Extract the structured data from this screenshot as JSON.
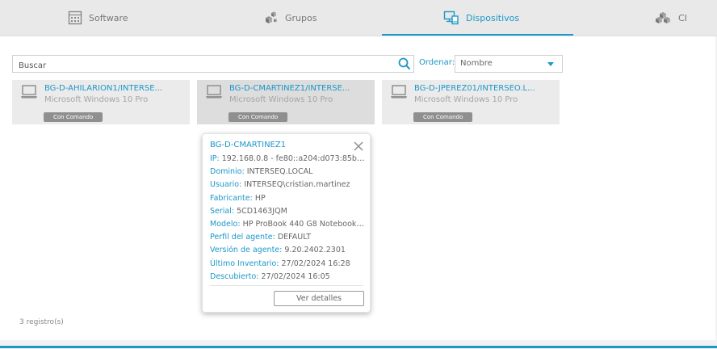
{
  "tabs": [
    {
      "label": "Software",
      "icon": "calculator-icon"
    },
    {
      "label": "Grupos",
      "icon": "cubes-icon"
    },
    {
      "label": "Dispositivos",
      "icon": "devices-icon"
    },
    {
      "label": "CI",
      "icon": "boxes-icon"
    }
  ],
  "active_tab": "Dispositivos",
  "search": {
    "placeholder": "Buscar",
    "value": ""
  },
  "sort": {
    "label": "Ordenar:",
    "selected": "Nombre"
  },
  "devices": [
    {
      "name": "BG-D-AHILARION1/INTERSE...",
      "os": "Microsoft Windows 10 Pro",
      "badge": "Con Comando"
    },
    {
      "name": "BG-D-CMARTINEZ1/INTERSE...",
      "os": "Microsoft Windows 10 Pro",
      "badge": "Con Comando"
    },
    {
      "name": "BG-D-JPEREZ01/INTERSEO.L...",
      "os": "Microsoft Windows 10 Pro",
      "badge": "Con Comando"
    }
  ],
  "record_count": "3 registro(s)",
  "popup": {
    "title": "BG-D-CMARTINEZ1",
    "rows": [
      {
        "key": "IP:",
        "value": "192.168.0.8 - fe80::a204:d073:85be:..."
      },
      {
        "key": "Dominio:",
        "value": "INTERSEQ.LOCAL"
      },
      {
        "key": "Usuario:",
        "value": "INTERSEQ\\cristian.martinez"
      },
      {
        "key": "Fabricante:",
        "value": "HP"
      },
      {
        "key": "Serial:",
        "value": "5CD1463JQM"
      },
      {
        "key": "Modelo:",
        "value": "HP ProBook 440 G8 Notebook ..."
      },
      {
        "key": "Perfil del agente:",
        "value": "DEFAULT"
      },
      {
        "key": "Versión de agente:",
        "value": "9.20.2402.2301"
      },
      {
        "key": "Último Inventario:",
        "value": "27/02/2024 16:28"
      },
      {
        "key": "Descubierto:",
        "value": "27/02/2024 16:05"
      }
    ],
    "button": "Ver detalles"
  },
  "colors": {
    "accent": "#1c97c9",
    "badge": "#8f8f8f",
    "card": "#ebebeb"
  }
}
